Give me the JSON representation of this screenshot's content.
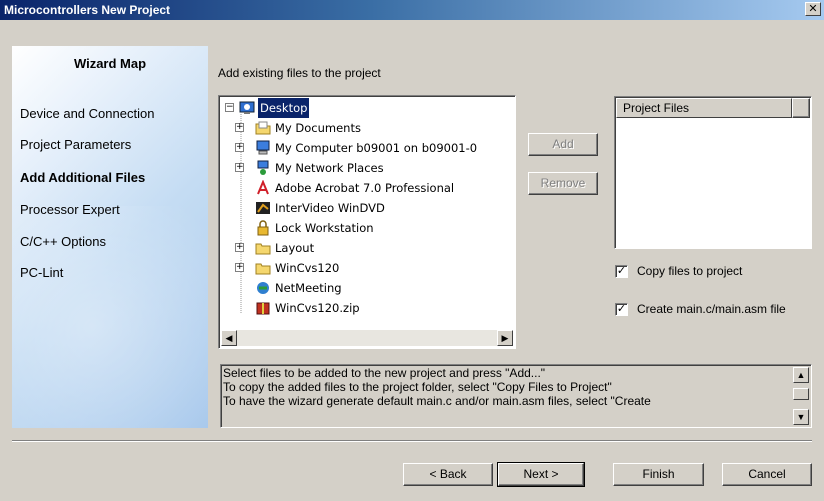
{
  "window": {
    "title": "Microcontrollers New Project",
    "close_label": "✕"
  },
  "wizard_map": {
    "title": "Wizard Map",
    "items": [
      {
        "label": "Device and Connection",
        "active": false
      },
      {
        "label": "Project Parameters",
        "active": false
      },
      {
        "label": "Add Additional Files",
        "active": true
      },
      {
        "label": "Processor Expert",
        "active": false
      },
      {
        "label": "C/C++ Options",
        "active": false
      },
      {
        "label": "PC-Lint",
        "active": false
      }
    ]
  },
  "heading": "Add existing files to the project",
  "tree": {
    "root": "Desktop",
    "items": [
      {
        "label": "My Documents",
        "icon": "folder-documents-icon",
        "expander": "+"
      },
      {
        "label": "My Computer b09001 on b09001-0",
        "icon": "computer-icon",
        "expander": "+"
      },
      {
        "label": "My Network Places",
        "icon": "network-icon",
        "expander": "+"
      },
      {
        "label": "Adobe Acrobat 7.0 Professional",
        "icon": "acrobat-icon",
        "expander": ""
      },
      {
        "label": "InterVideo WinDVD",
        "icon": "windvd-icon",
        "expander": ""
      },
      {
        "label": "Lock Workstation",
        "icon": "lock-icon",
        "expander": ""
      },
      {
        "label": "Layout",
        "icon": "folder-icon",
        "expander": "+"
      },
      {
        "label": "WinCvs120",
        "icon": "folder-icon",
        "expander": "+"
      },
      {
        "label": "NetMeeting",
        "icon": "netmeeting-icon",
        "expander": ""
      },
      {
        "label": "WinCvs120.zip",
        "icon": "zip-icon",
        "expander": ""
      }
    ]
  },
  "buttons": {
    "add": "Add",
    "remove": "Remove",
    "back": "< Back",
    "next": "Next >",
    "finish": "Finish",
    "cancel": "Cancel"
  },
  "project_files": {
    "header": "Project Files"
  },
  "options": {
    "copy_files": {
      "label": "Copy files to project",
      "checked": true,
      "mark": "✓"
    },
    "create_main": {
      "label": "Create main.c/main.asm file",
      "checked": true,
      "mark": "✓"
    }
  },
  "messages": [
    "Select files to be added to the new project and press \"Add...\"",
    "To copy the added files to the project folder, select \"Copy Files to Project\"",
    "To have the wizard generate default main.c and/or main.asm files, select \"Create"
  ],
  "colors": {
    "title_bar": "#0a246a",
    "selection": "#0a246a",
    "dialog_bg": "#d4d0c8"
  }
}
